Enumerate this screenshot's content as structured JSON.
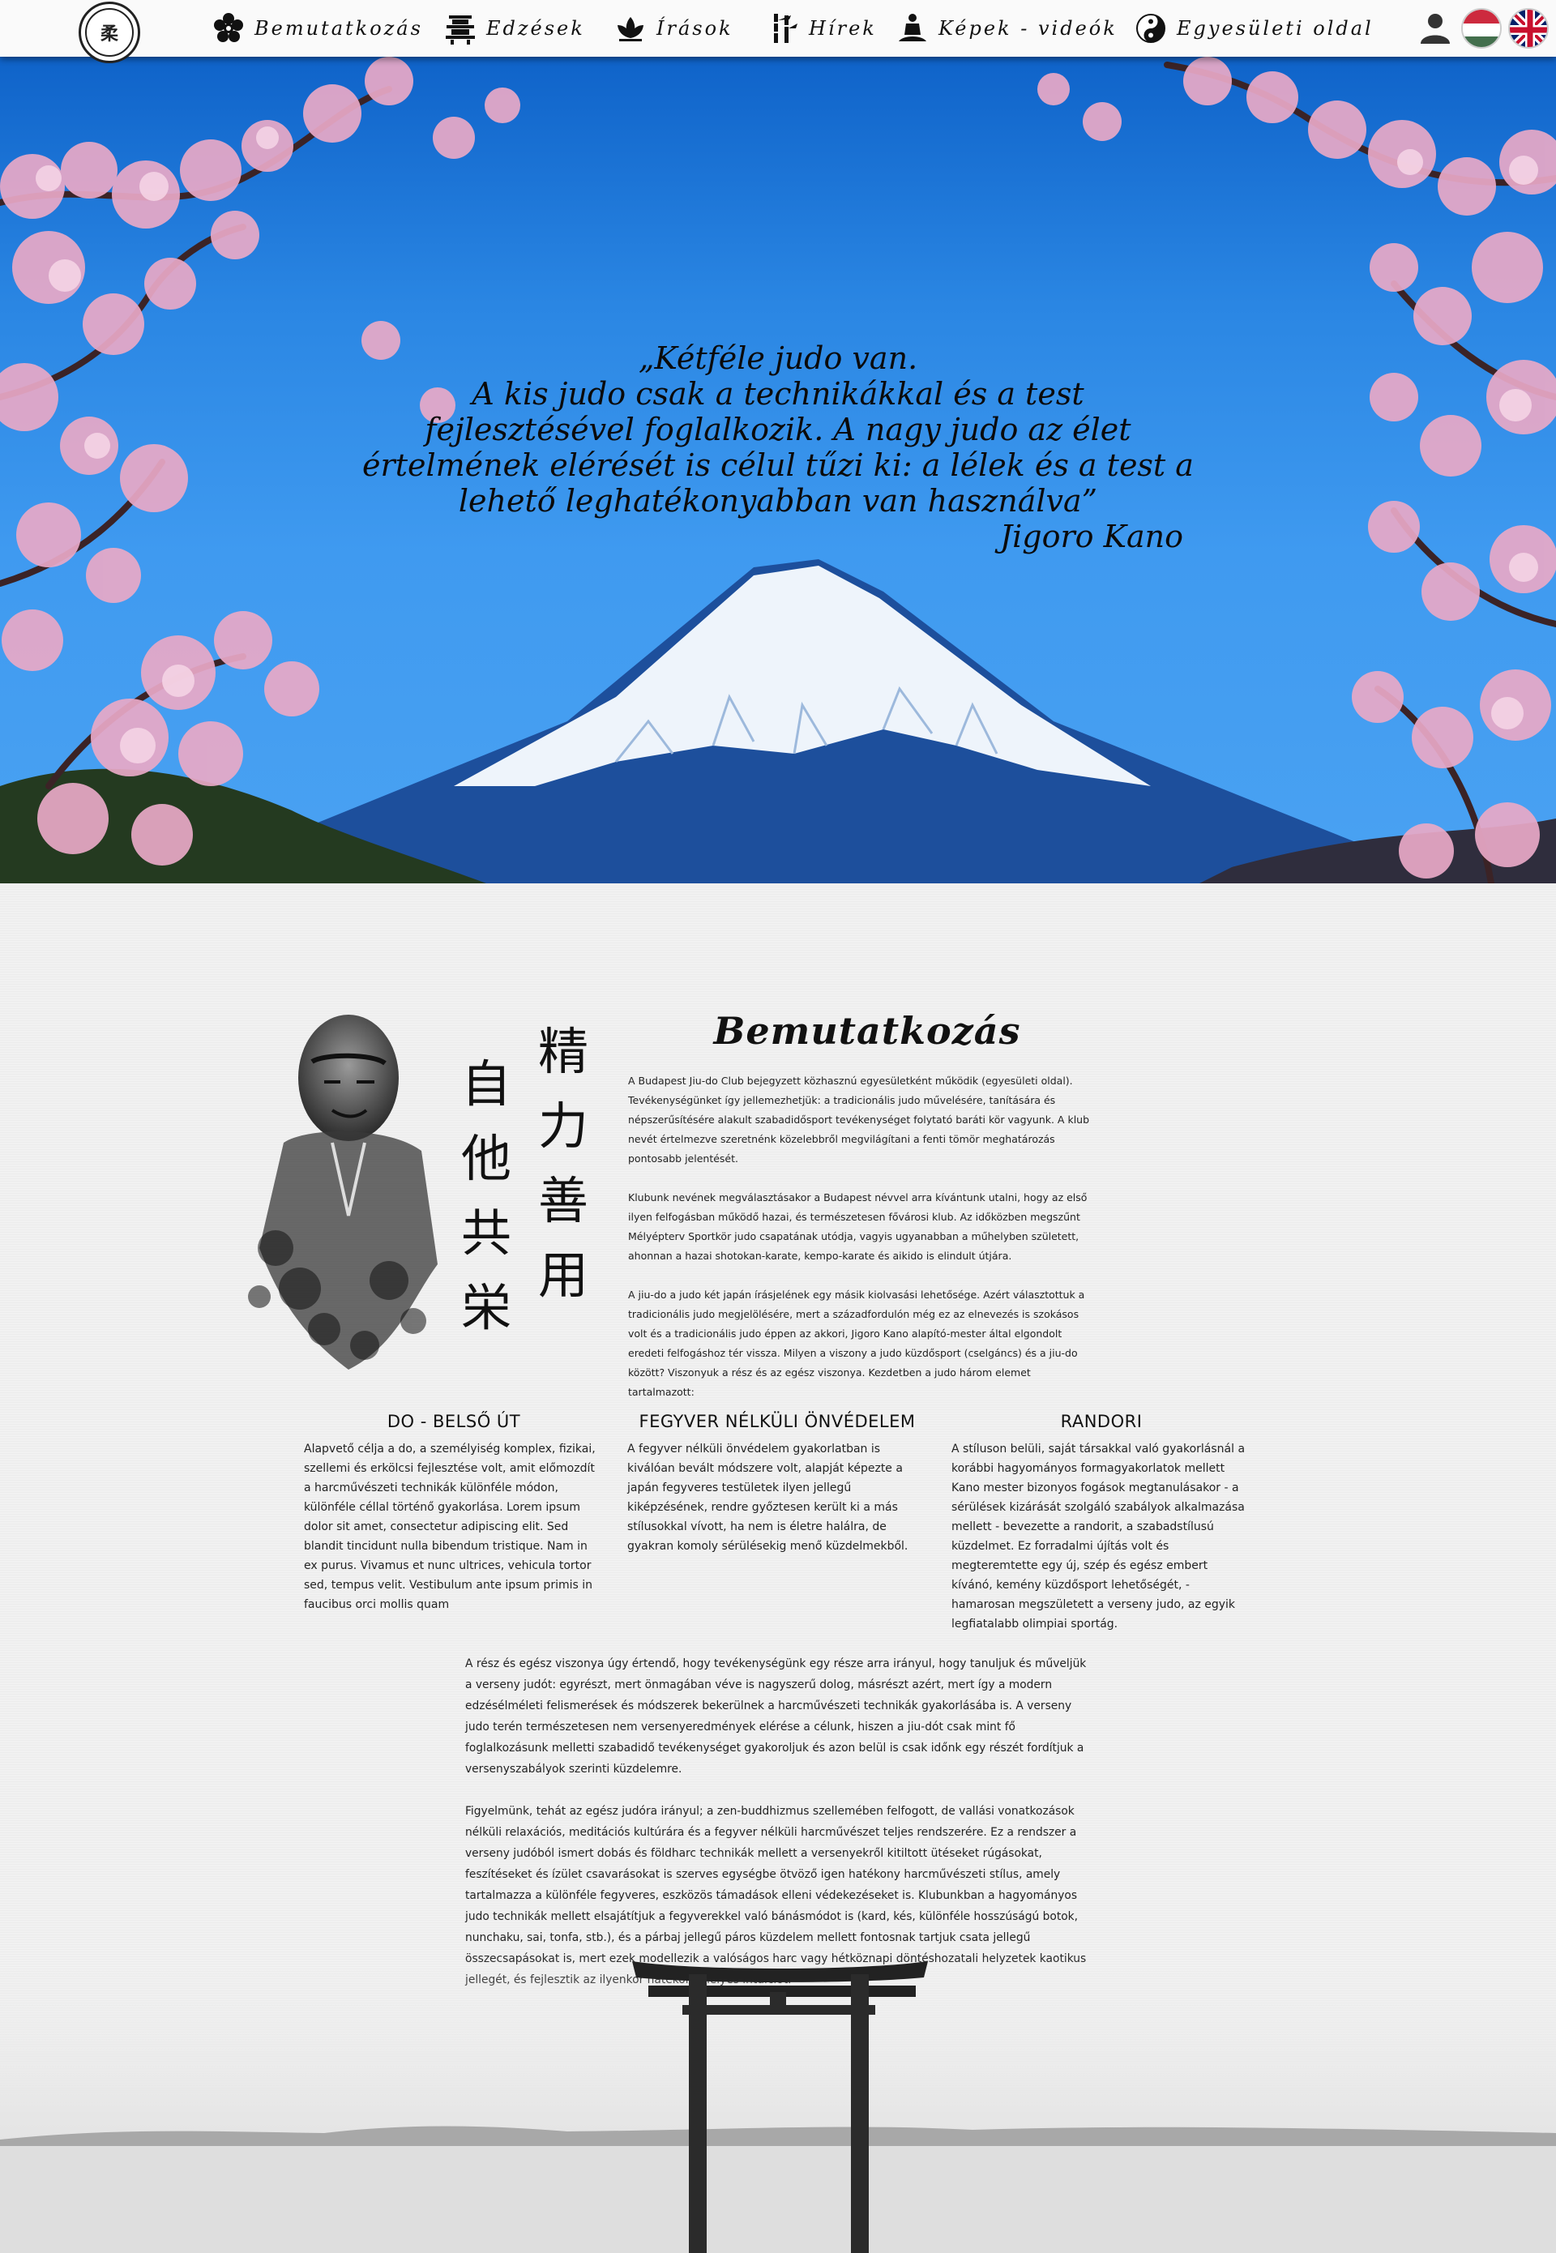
{
  "nav": {
    "logo_alt": "BUDAPEST JIU-DO CLUB",
    "items": [
      {
        "label": "Bemutatkozás",
        "icon": "flower-icon"
      },
      {
        "label": "Edzések",
        "icon": "pagoda-icon"
      },
      {
        "label": "Írások",
        "icon": "lotus-icon"
      },
      {
        "label": "Hírek",
        "icon": "bamboo-icon"
      },
      {
        "label": "Képek - videók",
        "icon": "meditation-icon"
      },
      {
        "label": "Egyesületi oldal",
        "icon": "yin-yang-icon"
      }
    ],
    "user_icon": "user-icon",
    "languages": [
      "hu",
      "en"
    ]
  },
  "hero": {
    "quote_lines": [
      "„Kétféle judo van.",
      "A kis judo csak a technikákkal és a test",
      "fejlesztésével foglalkozik. A nagy judo az élet",
      "értelmének elérését is célul tűzi ki: a lélek és a test a",
      "lehető leghatékonyabban van használva”"
    ],
    "author": "Jigoro Kano"
  },
  "about": {
    "title": "Bemutatkozás",
    "calligraphy_left": [
      "自",
      "他",
      "共",
      "栄"
    ],
    "calligraphy_right": [
      "精",
      "力",
      "善",
      "用"
    ],
    "intro": [
      "A Budapest Jiu-do Club bejegyzett közhasznú egyesületként működik (egyesületi oldal). Tevékenységünket így jellemezhetjük: a tradicionális judo művelésére, tanítására és népszerűsítésére alakult szabadidősport tevékenységet folytató baráti kör vagyunk. A klub nevét értelmezve szeretnénk közelebbről megvilágítani a fenti tömör meghatározás pontosabb jelentését.",
      "Klubunk nevének megválasztásakor a Budapest névvel arra kívántunk utalni, hogy az első ilyen felfogásban működő hazai, és természetesen fővárosi klub. Az időközben megszűnt Mélyépterv Sportkör judo csapatának utódja, vagyis ugyanabban a műhelyben született, ahonnan a hazai shotokan-karate, kempo-karate és aikido is elindult útjára.",
      "A jiu-do a judo két japán írásjelének egy másik kiolvasási lehetősége. Azért választottuk a tradicionális judo megjelölésére, mert a századfordulón még ez az elnevezés is szokásos volt és a tradicionális judo éppen az akkori, Jigoro Kano alapító-mester által elgondolt eredeti felfogáshoz tér vissza. Milyen a viszony a judo küzdősport (cselgáncs) és a jiu-do között? Viszonyuk a rész és az egész viszonya. Kezdetben a judo három elemet tartalmazott:"
    ]
  },
  "columns": [
    {
      "title": "DO - BELSŐ ÚT",
      "text": "Alapvető célja a do, a személyiség komplex, fizikai, szellemi és erkölcsi fejlesztése volt, amit előmozdít a harcművészeti technikák különféle módon, különféle céllal történő gyakorlása. Lorem ipsum dolor sit amet, consectetur adipiscing elit. Sed blandit tincidunt nulla bibendum tristique. Nam in ex purus. Vivamus et nunc ultrices, vehicula tortor sed, tempus velit. Vestibulum ante ipsum primis in faucibus orci mollis quam"
    },
    {
      "title": "FEGYVER NÉLKÜLI ÖNVÉDELEM",
      "text": "A fegyver nélküli önvédelem gyakorlatban is kiválóan bevált módszere volt, alapját képezte a japán fegyveres testületek ilyen jellegű kiképzésének, rendre győztesen került ki a más stílusokkal vívott, ha nem is életre halálra, de gyakran komoly sérülésekig menő küzdelmekből."
    },
    {
      "title": "RANDORI",
      "text": "A stíluson belüli, saját társakkal való gyakorlásnál a korábbi hagyományos formagyakorlatok mellett Kano mester bizonyos fogások megtanulásakor - a sérülések kizárását szolgáló szabályok alkalmazása mellett - bevezette a randorit, a szabadstílusú küzdelmet. Ez forradalmi újítás volt és megteremtette egy új, szép és egész embert kívánó, kemény küzdősport lehetőségét, - hamarosan megszületett a verseny judo, az egyik legfiatalabb olimpiai sportág."
    }
  ],
  "body": [
    "A rész és egész viszonya úgy értendő, hogy tevékenységünk egy része arra irányul, hogy tanuljuk és műveljük a verseny judót: egyrészt, mert önmagában véve is nagyszerű dolog, másrészt azért, mert így a modern edzésélméleti felismerések és módszerek bekerülnek a harcművészeti technikák gyakorlásába is. A verseny judo terén természetesen nem versenyeredmények elérése a célunk, hiszen a jiu-dót csak mint fő foglalkozásunk melletti szabadidő tevékenységet gyakoroljuk és azon belül is csak időnk egy részét fordítjuk a versenyszabályok szerinti küzdelemre.",
    "Figyelmünk, tehát az egész judóra irányul; a zen-buddhizmus szellemében felfogott, de vallási vonatkozások nélküli relaxációs, meditációs kultúrára és a fegyver nélküli harcművészet teljes rendszerére. Ez a rendszer a verseny judóból ismert dobás és földharc technikák mellett a versenyekről kitiltott ütéseket rúgásokat, feszítéseket és ízület csavarásokat is szerves egységbe ötvöző igen hatékony harcművészeti stílus, amely tartalmazza a különféle fegyveres, eszközös támadások elleni védekezéseket is. Klubunkban a hagyományos judo technikák mellett elsajátítjuk a fegyverekkel való bánásmódot is (kard, kés, különféle hosszúságú botok, nunchaku, sai, tonfa, stb.), és a párbaj jellegű páros küzdelem mellett fontosnak tartjuk csata jellegű összecsapásokat is, mert ezek modellezik a valóságos harc vagy hétköznapi döntéshozatali helyzetek kaotikus jellegét, és fejlesztik az ilyenkor hatékony helyes intuíciót."
  ],
  "colors": {
    "sky": "#2a86e3",
    "nav_bg": "#fafafa",
    "page_bg": "#efefef",
    "text": "#222222",
    "blossom": "#e9a9c7"
  }
}
